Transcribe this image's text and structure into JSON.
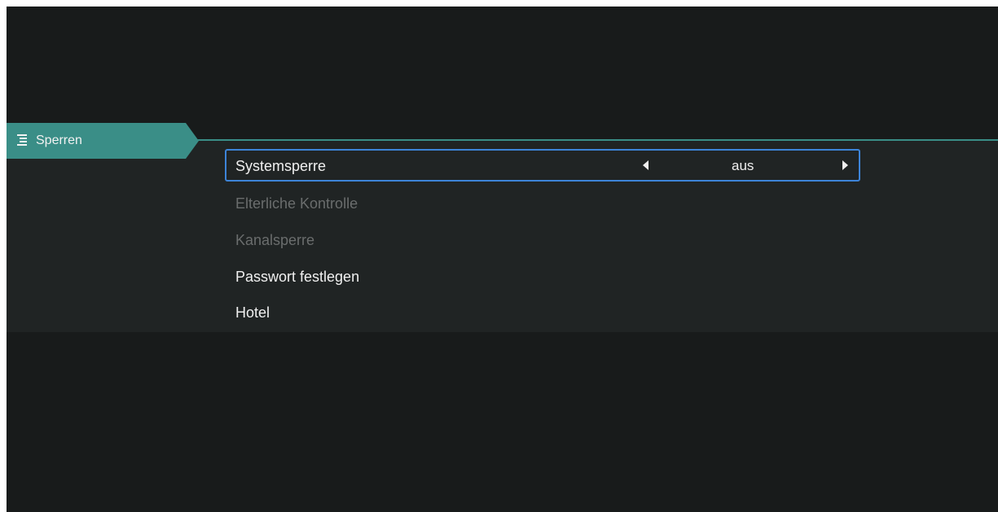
{
  "section": {
    "title": "Sperren",
    "icon": "list-icon"
  },
  "colors": {
    "accent": "#3a8e87",
    "focus_border": "#3d84d8",
    "background": "#181b1b"
  },
  "menu": {
    "items": [
      {
        "label": "Systemsperre",
        "value": "aus",
        "selected": true,
        "enabled": true
      },
      {
        "label": "Elterliche Kontrolle",
        "enabled": false
      },
      {
        "label": "Kanalsperre",
        "enabled": false
      },
      {
        "label": "Passwort festlegen",
        "enabled": true
      },
      {
        "label": "Hotel",
        "enabled": true
      }
    ]
  }
}
